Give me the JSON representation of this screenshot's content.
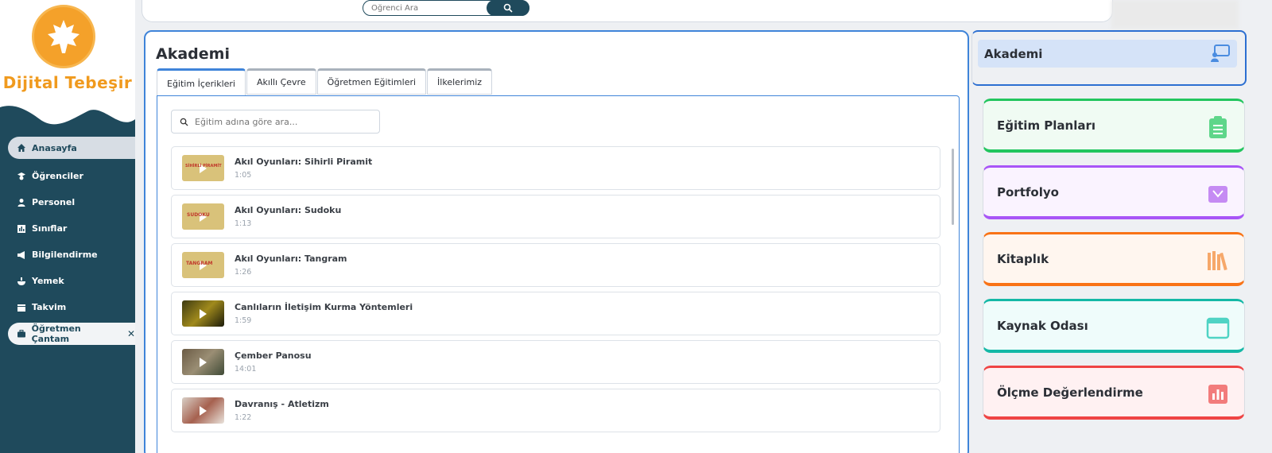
{
  "brand": {
    "name": "Dijital Tebeşir",
    "logo_color": "#f4a12a"
  },
  "sidebar": {
    "items": [
      {
        "label": "Anasayfa",
        "icon": "home-icon"
      },
      {
        "label": "Öğrenciler",
        "icon": "students-icon"
      },
      {
        "label": "Personel",
        "icon": "personnel-icon"
      },
      {
        "label": "Sınıflar",
        "icon": "classes-icon"
      },
      {
        "label": "Bilgilendirme",
        "icon": "megaphone-icon"
      },
      {
        "label": "Yemek",
        "icon": "meal-icon"
      },
      {
        "label": "Takvim",
        "icon": "calendar-icon"
      },
      {
        "label": "Öğretmen Çantam",
        "icon": "briefcase-icon",
        "close": "✕"
      }
    ]
  },
  "topbar": {
    "search_placeholder": "Öğrenci Ara"
  },
  "main": {
    "title": "Akademi",
    "tabs": [
      "Eğitim İçerikleri",
      "Akıllı Çevre",
      "Öğretmen Eğitimleri",
      "İlkelerimiz"
    ],
    "active_tab": "Eğitim İçerikleri",
    "search_placeholder": "Eğitim adına göre ara...",
    "items": [
      {
        "title": "Akıl Oyunları: Sihirli Piramit",
        "duration": "1:05",
        "thumb_text": "SİHİRLİ PİRAMİT"
      },
      {
        "title": "Akıl Oyunları: Sudoku",
        "duration": "1:13",
        "thumb_text": "SUDOKU"
      },
      {
        "title": "Akıl Oyunları: Tangram",
        "duration": "1:26",
        "thumb_text": "TANGRAM"
      },
      {
        "title": "Canlıların İletişim Kurma Yöntemleri",
        "duration": "1:59"
      },
      {
        "title": "Çember Panosu",
        "duration": "14:01"
      },
      {
        "title": "Davranış - Atletizm",
        "duration": "1:22"
      }
    ]
  },
  "right_panel": {
    "cards": [
      {
        "label": "Akademi",
        "icon": "academy-icon",
        "color": "#2c6fd1"
      },
      {
        "label": "Eğitim Planları",
        "icon": "clipboard-icon",
        "color": "#22c55e"
      },
      {
        "label": "Portfolyo",
        "icon": "portfolio-icon",
        "color": "#a855f7"
      },
      {
        "label": "Kitaplık",
        "icon": "books-icon",
        "color": "#f97316"
      },
      {
        "label": "Kaynak Odası",
        "icon": "calendar-icon",
        "color": "#14b8a6"
      },
      {
        "label": "Ölçme Değerlendirme",
        "icon": "chart-icon",
        "color": "#ef4444"
      }
    ]
  }
}
